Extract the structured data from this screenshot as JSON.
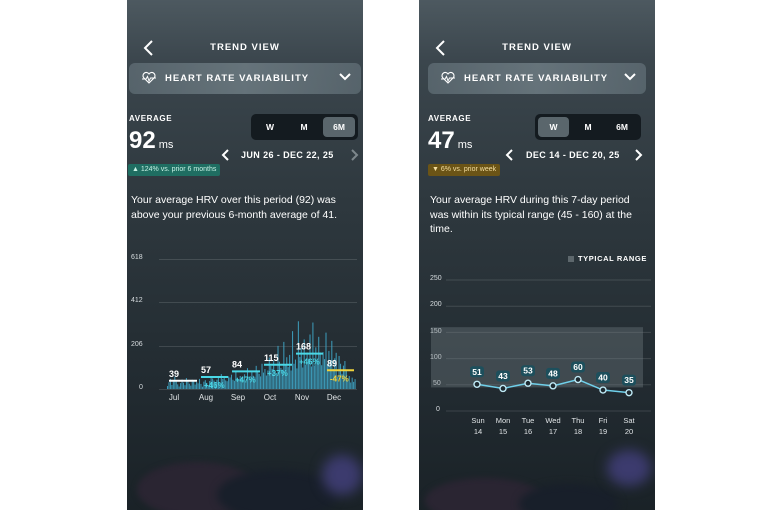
{
  "left_phone": {
    "header_title": "TREND VIEW",
    "metric": "HEART RATE VARIABILITY",
    "average_label": "AVERAGE",
    "average_value": "92",
    "average_unit": "ms",
    "period_tabs": [
      "W",
      "M",
      "6M"
    ],
    "selected_tab": "6M",
    "date_range": "JUN 26 - DEC 22, 25",
    "comparison_badge": "▲ 124% vs. prior 6 months",
    "badge_color": "#2ea88a",
    "summary": "Your average HRV over this period (92) was above your previous 6-month average of 41.",
    "chart_data": {
      "type": "bar",
      "ylim": [
        0,
        618
      ],
      "yticks": [
        0,
        206,
        412,
        618
      ],
      "xlabel_ticks": [
        "Jul",
        "Aug",
        "Sep",
        "Oct",
        "Nov",
        "Dec"
      ],
      "series": [
        {
          "values": [
            14,
            32,
            48,
            19,
            41,
            58,
            36,
            22,
            12,
            28,
            45,
            30,
            18,
            52,
            37,
            25,
            16,
            44,
            39,
            21,
            33,
            27,
            48,
            24,
            11,
            35,
            42,
            29,
            17,
            38,
            60,
            50,
            40,
            33,
            44,
            55,
            30,
            71,
            48,
            52,
            41,
            37,
            60,
            55,
            68,
            44,
            39,
            81,
            53,
            47,
            62,
            52,
            45,
            70,
            35,
            99,
            58,
            49,
            80,
            63,
            56,
            110,
            85,
            72,
            60,
            120,
            78,
            95,
            64,
            88,
            150,
            110,
            96,
            134,
            82,
            76,
            205,
            130,
            100,
            92,
            224,
            118,
            151,
            104,
            162,
            88,
            275,
            120,
            140,
            98,
            322,
            152,
            196,
            102,
            236,
            116,
            174,
            144,
            259,
            107,
            316,
            112,
            198,
            139,
            248,
            174,
            113,
            175,
            142,
            268,
            117,
            181,
            129,
            229,
            96,
            146,
            172,
            58,
            157,
            120,
            72,
            111,
            133,
            87,
            45,
            62,
            31,
            54,
            34,
            47
          ]
        }
      ],
      "monthly_averages": [
        {
          "month": "Jul",
          "value": 39,
          "change": ""
        },
        {
          "month": "Aug",
          "value": 57,
          "change": "+46%"
        },
        {
          "month": "Sep",
          "value": 84,
          "change": "+47%"
        },
        {
          "month": "Oct",
          "value": 115,
          "change": "+37%"
        },
        {
          "month": "Nov",
          "value": 168,
          "change": "+46%"
        },
        {
          "month": "Dec",
          "value": 89,
          "change": "-47%"
        }
      ]
    }
  },
  "right_phone": {
    "header_title": "TREND VIEW",
    "metric": "HEART RATE VARIABILITY",
    "average_label": "AVERAGE",
    "average_value": "47",
    "average_unit": "ms",
    "period_tabs": [
      "W",
      "M",
      "6M"
    ],
    "selected_tab": "W",
    "date_range": "DEC 14 - DEC 20, 25",
    "comparison_badge": "▼ 6% vs. prior week",
    "badge_color": "#c99a2c",
    "summary": "Your average HRV during this 7-day period was within its typical range (45 - 160) at the time.",
    "legend_label": "TYPICAL RANGE",
    "chart_data": {
      "type": "line",
      "ylim": [
        0,
        250
      ],
      "yticks": [
        0,
        50,
        100,
        150,
        200,
        250
      ],
      "typical_range": [
        45,
        160
      ],
      "days": [
        "Sun",
        "Mon",
        "Tue",
        "Wed",
        "Thu",
        "Fri",
        "Sat"
      ],
      "dates": [
        "14",
        "15",
        "16",
        "17",
        "18",
        "19",
        "20"
      ],
      "values": [
        51,
        43,
        53,
        48,
        60,
        40,
        35
      ]
    }
  }
}
